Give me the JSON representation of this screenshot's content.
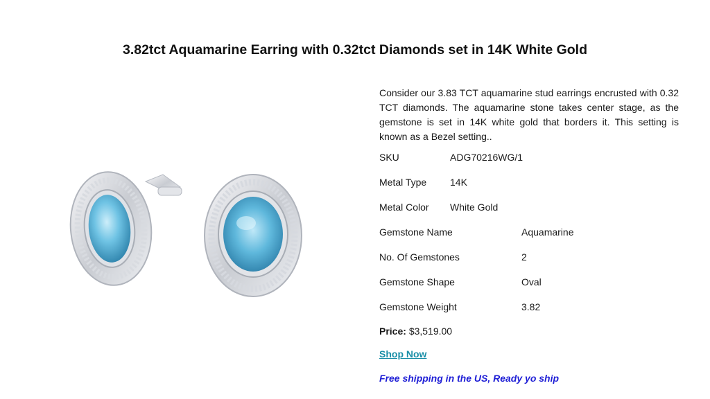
{
  "title": "3.82tct Aquamarine Earring with 0.32tct Diamonds set in 14K White Gold",
  "description": "Consider our 3.83 TCT aquamarine stud earrings encrusted with 0.32 TCT diamonds. The aquamarine stone takes center stage, as the gemstone is set in 14K white gold that borders it. This setting is known as a Bezel setting..",
  "specs": [
    {
      "label": "SKU",
      "value": "ADG70216WG/1"
    },
    {
      "label": "Metal Type",
      "value": "14K"
    },
    {
      "label": "Metal Color",
      "value": "White Gold"
    },
    {
      "label": "Gemstone Name",
      "value": "Aquamarine"
    },
    {
      "label": "No. Of Gemstones",
      "value": "2"
    },
    {
      "label": "Gemstone Shape",
      "value": "Oval"
    },
    {
      "label": "Gemstone Weight",
      "value": "3.82"
    }
  ],
  "price": {
    "label": "Price:",
    "value": "$3,519.00"
  },
  "shop_now": "Shop Now",
  "shipping": "Free shipping in the US, Ready yo ship",
  "colors": {
    "link": "#1a8fa8",
    "shipping": "#1f1fd6",
    "gem": "#5fb8dc"
  }
}
